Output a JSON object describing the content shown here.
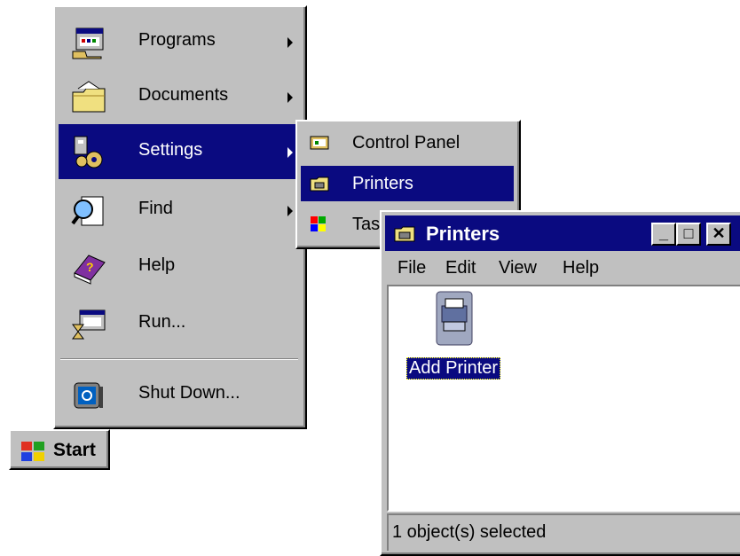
{
  "start_menu": {
    "items": [
      {
        "label": "Programs",
        "icon": "programs-icon",
        "has_submenu": true
      },
      {
        "label": "Documents",
        "icon": "documents-icon",
        "has_submenu": true
      },
      {
        "label": "Settings",
        "icon": "settings-icon",
        "has_submenu": true,
        "selected": true
      },
      {
        "label": "Find",
        "icon": "find-icon",
        "has_submenu": true
      },
      {
        "label": "Help",
        "icon": "help-icon",
        "has_submenu": false
      },
      {
        "label": "Run...",
        "icon": "run-icon",
        "has_submenu": false
      },
      {
        "label": "Shut Down...",
        "icon": "shutdown-icon",
        "has_submenu": false
      }
    ]
  },
  "settings_submenu": {
    "items": [
      {
        "label": "Control Panel",
        "icon": "control-panel-icon"
      },
      {
        "label": "Printers",
        "icon": "printers-folder-icon",
        "selected": true
      },
      {
        "label": "Taskbar...",
        "icon": "taskbar-icon"
      }
    ]
  },
  "taskbar": {
    "start_label": "Start"
  },
  "printers_window": {
    "title": "Printers",
    "menu": [
      "File",
      "Edit",
      "View",
      "Help"
    ],
    "items": [
      {
        "label": "Add Printer",
        "icon": "add-printer-icon",
        "selected": true
      }
    ],
    "status": "1 object(s) selected",
    "controls": {
      "minimize": "_",
      "maximize": "□",
      "close": "✕"
    }
  },
  "colors": {
    "face": "#c0c0c0",
    "selection": "#0a0a80",
    "client": "#ffffff"
  }
}
